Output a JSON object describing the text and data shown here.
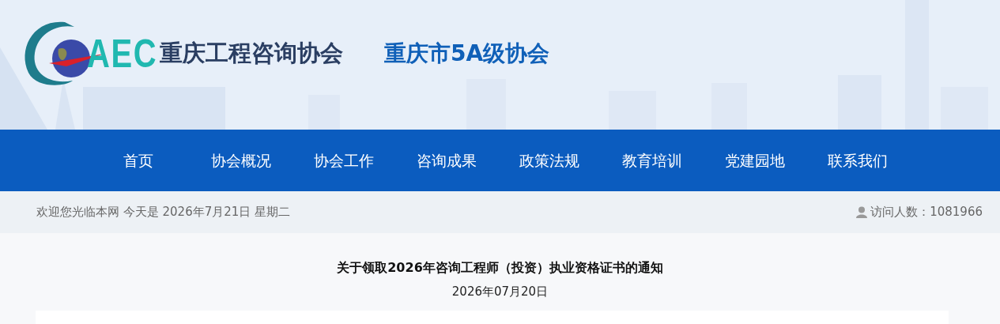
{
  "header": {
    "logo_text": "AEC",
    "site_name": "重庆工程咨询协会",
    "badge": "重庆市5A级协会"
  },
  "nav": {
    "items": [
      {
        "label": "首页",
        "selected": false
      },
      {
        "label": "协会概况",
        "selected": false
      },
      {
        "label": "协会工作",
        "selected": false
      },
      {
        "label": "咨询成果",
        "selected": false
      },
      {
        "label": "政策法规",
        "selected": false
      },
      {
        "label": "教育培训",
        "selected": false
      },
      {
        "label": "党建园地",
        "selected": false
      },
      {
        "label": "联系我们",
        "selected": false
      }
    ]
  },
  "info_bar": {
    "welcome": "欢迎您光临本网 今天是 2026年7月21日  星期二",
    "visitors": "访问人数：1081966"
  },
  "article": {
    "title": "关于领取2026年咨询工程师（投资）执业资格证书的通知",
    "date": "2026年07月20日"
  }
}
